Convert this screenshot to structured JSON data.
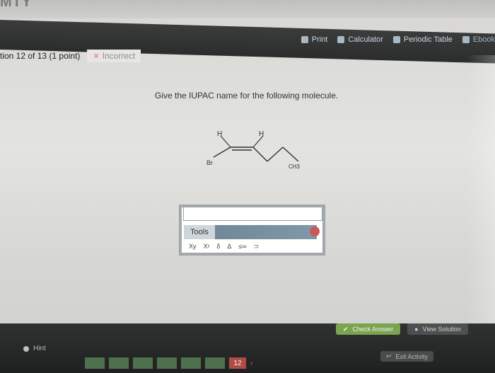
{
  "app": {
    "brand": "MTY"
  },
  "toolbar": {
    "items": [
      {
        "label": "Print",
        "icon": "printer-icon"
      },
      {
        "label": "Calculator",
        "icon": "calculator-icon"
      },
      {
        "label": "Periodic Table",
        "icon": "table-icon"
      },
      {
        "label": "Ebook",
        "icon": "book-icon"
      }
    ]
  },
  "question": {
    "header": "tion 12 of 13 (1 point)",
    "status": "Incorrect",
    "status_icon": "close-icon",
    "prompt": "Give the IUPAC name for the following molecule."
  },
  "molecule": {
    "labels": {
      "h_left": "H",
      "h_right": "H",
      "br": "Br",
      "ch3": "CH3"
    }
  },
  "tools": {
    "label": "Tools",
    "close_icon": "close-icon",
    "items": [
      "Xy",
      "Xʸ",
      "δ",
      "Δ",
      "≤∞",
      "⊃"
    ]
  },
  "footer": {
    "hint": "Hint",
    "check_answer": "Check Answer",
    "view_solution": "View Solution",
    "exit_activity": "Exit Activity",
    "current_page": "12"
  },
  "colors": {
    "toolbar_bg": "#2f3130",
    "incorrect_x": "#d37a79",
    "check_answer": "#7aa44f",
    "exit_bg": "#4a4c4b",
    "pager_green": "#4f704e",
    "pager_red": "#b04c45"
  }
}
